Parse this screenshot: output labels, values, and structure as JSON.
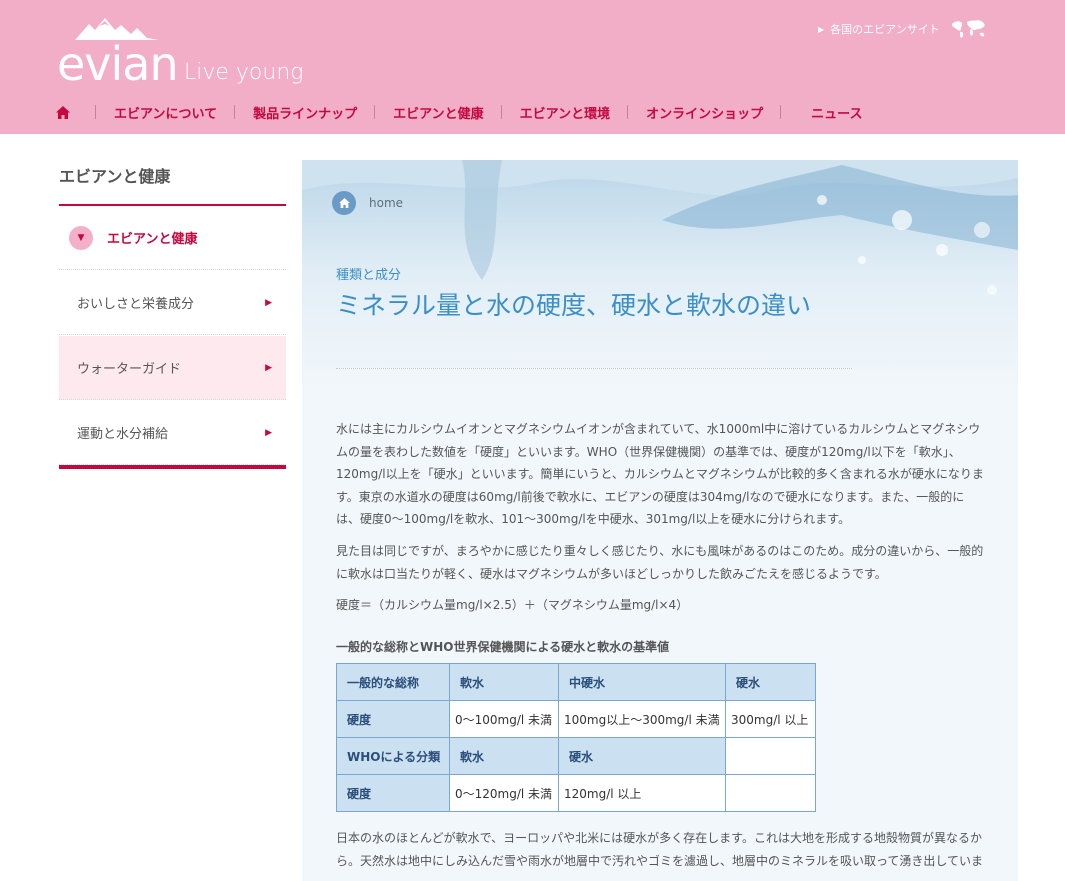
{
  "header": {
    "brand": "evian",
    "tagline": "Live young",
    "global_link": "各国のエビアンサイト",
    "nav": [
      {
        "label": "エビアンについて"
      },
      {
        "label": "製品ラインナップ"
      },
      {
        "label": "エビアンと健康"
      },
      {
        "label": "エビアンと環境"
      },
      {
        "label": "オンラインショップ"
      },
      {
        "label": "ニュース"
      }
    ]
  },
  "sidebar": {
    "title": "エビアンと健康",
    "items": [
      {
        "label": "エビアンと健康"
      },
      {
        "label": "おいしさと栄養成分"
      },
      {
        "label": "ウォーターガイド"
      },
      {
        "label": "運動と水分補給"
      }
    ]
  },
  "main": {
    "breadcrumb": "home",
    "category": "種類と成分",
    "title": "ミネラル量と水の硬度、硬水と軟水の違い",
    "para1": "水には主にカルシウムイオンとマグネシウムイオンが含まれていて、水1000ml中に溶けているカルシウムとマグネシウムの量を表わした数値を「硬度」といいます。WHO（世界保健機関）の基準では、硬度が120mg/l以下を「軟水」、120mg/l以上を「硬水」といいます。簡単にいうと、カルシウムとマグネシウムが比較的多く含まれる水が硬水になります。東京の水道水の硬度は60mg/l前後で軟水に、エビアンの硬度は304mg/lなので硬水になります。また、一般的には、硬度0～100mg/lを軟水、101～300mg/lを中硬水、301mg/l以上を硬水に分けられます。",
    "para2": "見た目は同じですが、まろやかに感じたり重々しく感じたり、水にも風味があるのはこのため。成分の違いから、一般的に軟水は口当たりが軽く、硬水はマグネシウムが多いほどしっかりした飲みごたえを感じるようです。",
    "formula": "硬度＝（カルシウム量mg/l×2.5）＋（マグネシウム量mg/l×4）",
    "table_caption": "一般的な総称とWHO世界保健機関による硬水と軟水の基準値",
    "table": {
      "row1": [
        "一般的な総称",
        "軟水",
        "中硬水",
        "硬水"
      ],
      "row2": [
        "硬度",
        "0～100mg/l 未満",
        "100mg以上～300mg/l 未満",
        "300mg/l 以上"
      ],
      "row3": [
        "WHOによる分類",
        "軟水",
        "硬水",
        ""
      ],
      "row4": [
        "硬度",
        "0～120mg/l 未満",
        "120mg/l 以上",
        ""
      ]
    },
    "para3": "日本の水のほとんどが軟水で、ヨーロッパや北米には硬水が多く存在します。これは大地を形成する地殻物質が異なるから。天然水は地中にしみ込んだ雪や雨水が地層中で汚れやゴミを濾過し、地層中のミネラルを吸い取って湧き出していま"
  },
  "colors": {
    "header_bg": "#f1aec6",
    "accent": "#c4093f",
    "title_blue": "#3c8fc6",
    "table_header": "#cbe0f1"
  },
  "icons": [
    "home-icon",
    "triangle-right-icon",
    "world-map-icon",
    "chevron-down-icon",
    "chevron-right-icon",
    "mountain-logo-icon"
  ]
}
